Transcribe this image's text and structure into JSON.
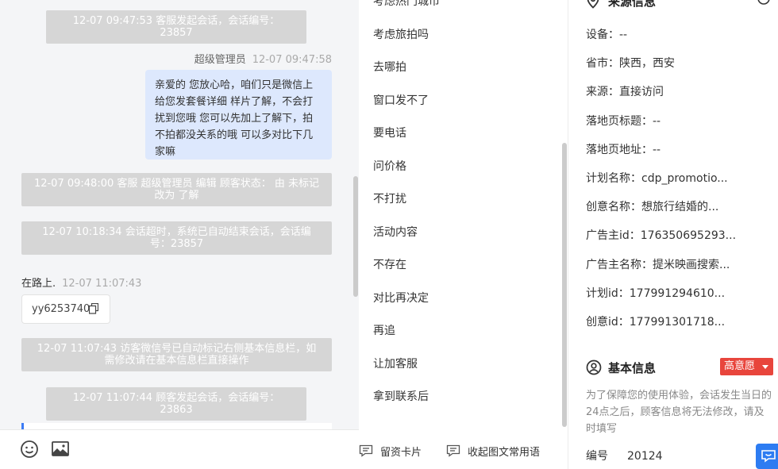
{
  "chat": {
    "sys1": "12-07 09:47:53 客服发起会话，会话编号：23857",
    "out_sender": "超级管理员",
    "out_time": "12-07 09:47:58",
    "out_text": "亲爱的 您放心哈，咱们只是微信上给您发套餐详细 样片了解，不会打扰到您哦 您可以先加上了解下，拍不拍都没关系的哦 可以多对比下几家嘛",
    "sys2": "12-07 09:48:00 客服 超级管理员 编辑 顾客状态： 由 未标记 改为 了解",
    "sys3": "12-07 10:18:34 会话超时，系统已自动结束会话，会话编号：23857",
    "in_sender": "在路上.",
    "in_time": "12-07 11:07:43",
    "in_text": "yy6253740",
    "sys4": "12-07 11:07:43 访客微信号已自动标记右侧基本信息栏，如需修改请在基本信息栏直接操作",
    "sys5": "12-07 11:07:44 顾客发起会话，会话编号：23863"
  },
  "quick_replies": [
    "考虑热门城市",
    "考虑旅拍吗",
    "去哪拍",
    "窗口发不了",
    "要电话",
    "问价格",
    "不打扰",
    "活动内容",
    "不存在",
    "对比再决定",
    "再追",
    "让加客服",
    "拿到联系后"
  ],
  "quick_footer": {
    "card_label": "留资卡片",
    "collapse_label": "收起图文常用语"
  },
  "info": {
    "source_title": "来源信息",
    "source_rows": [
      "设备：--",
      "省市：陕西，西安",
      "来源：直接访问",
      "落地页标题：--",
      "落地页地址：--",
      "计划名称：cdp_promotio...",
      "创意名称：想旅行结婚的...",
      "广告主id：176350695293...",
      "广告主名称：提米映画搜索...",
      "计划id：177991294610...",
      "创意id：177991301718..."
    ],
    "basic_title": "基本信息",
    "intent_badge": "高意愿",
    "hint": "为了保障您的使用体验，会话发生当日的24点之后，顾客信息将无法修改，请及时填写",
    "id_label": "编号",
    "id_value": "20124"
  },
  "colors": {
    "accent": "#2d7cf2",
    "badge_red": "#e8453c",
    "bubble_blue": "#dde8fd",
    "system_gray": "#d6d6d6"
  },
  "icons": [
    "copy-icon",
    "emoji-icon",
    "image-icon",
    "card-icon",
    "collapse-icon",
    "location-icon",
    "user-icon",
    "chat-float-icon"
  ]
}
